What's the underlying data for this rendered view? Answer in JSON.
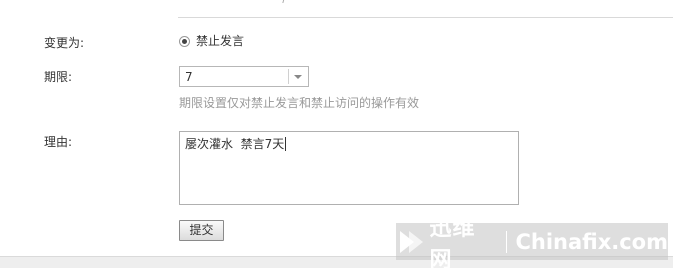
{
  "form": {
    "change_to": {
      "label": "变更为:",
      "option_label": "禁止发言"
    },
    "period": {
      "label": "期限:",
      "selected": "7",
      "hint": "期限设置仅对禁止发言和禁止访问的操作有效"
    },
    "reason": {
      "label": "理由:",
      "value": "屡次灌水  禁言7天"
    },
    "submit_label": "提交"
  },
  "watermark": {
    "cn_text": "迅维网",
    "en_text": "Chinafix.com"
  }
}
